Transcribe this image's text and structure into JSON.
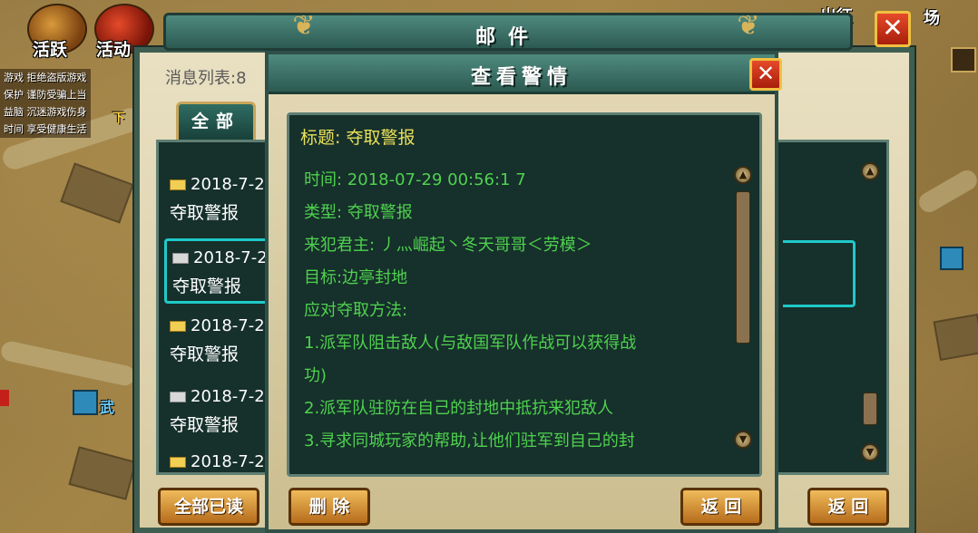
{
  "hud": {
    "activity_label": "活跃",
    "event_label": "活动",
    "expedition_label": "出征",
    "arena_label": "场",
    "wu_label": "武",
    "xia_label": "下",
    "side_notices": [
      "游戏 拒绝盗版游戏",
      "保护 谨防受骗上当",
      "益脑 沉迷游戏伤身",
      "时间 享受健康生活"
    ]
  },
  "mail": {
    "title": "邮件",
    "list_label": "消息列表:8",
    "tab_all": "全部",
    "items": [
      {
        "date": "2018-7-2",
        "subject": "夺取警报",
        "read": false
      },
      {
        "date": "2018-7-2",
        "subject": "夺取警报",
        "read": true
      },
      {
        "date": "2018-7-2",
        "subject": "夺取警报",
        "read": false
      },
      {
        "date": "2018-7-2",
        "subject": "夺取警报",
        "read": true
      },
      {
        "date": "2018-7-2",
        "subject": "",
        "read": false
      }
    ],
    "mark_all_read_label": "全部已读",
    "back_label": "返 回",
    "close_glyph": "✕"
  },
  "alert": {
    "title": "查看警情",
    "close_glyph": "✕",
    "subject": "标题: 夺取警报",
    "lines": [
      "时间: 2018-07-29 00:56:1 7",
      "类型: 夺取警报",
      "来犯君主: 丿灬崛起丶冬天哥哥＜劳模＞",
      "目标:边亭封地",
      "应对夺取方法:",
      "1.派军队阻击敌人(与敌国军队作战可以获得战",
      "功)",
      "2.派军队驻防在自己的封地中抵抗来犯敌人",
      "3.寻求同城玩家的帮助,让他们驻军到自己的封"
    ],
    "delete_label": "删 除",
    "back_label": "返 回"
  },
  "colors": {
    "panel_bg": "#16302b",
    "text_green": "#4fd24f",
    "title_yellow": "#e8e05a",
    "selection_cyan": "#1fc9c9",
    "button_orange": "#d88f34"
  }
}
